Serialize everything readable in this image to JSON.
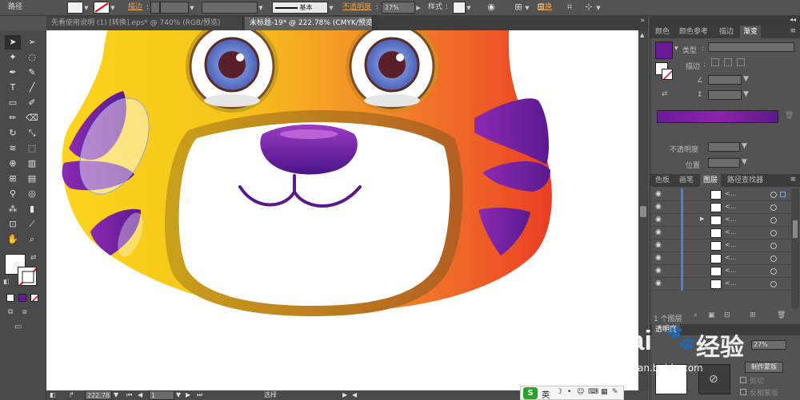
{
  "control_bar": {
    "object_type": "路径",
    "stroke_label": "描边",
    "stroke_style_label": "基本",
    "opacity_label": "不透明度",
    "opacity_value": "27%",
    "style_label": "样式",
    "transform_label": "变换"
  },
  "document_tabs": [
    {
      "label": "先看使用说明 (1) [转换].eps* @ 740% (RGB/预览)",
      "active": false
    },
    {
      "label": "未标题-19* @ 222.78% (CMYK/预览)",
      "active": true
    }
  ],
  "tools": [
    {
      "icon": "selection-arrow-icon",
      "glyph": "➤"
    },
    {
      "icon": "direct-selection-icon",
      "glyph": "➢"
    },
    {
      "icon": "magic-wand-icon",
      "glyph": "✦"
    },
    {
      "icon": "lasso-icon",
      "glyph": "◌"
    },
    {
      "icon": "pen-icon",
      "glyph": "✒"
    },
    {
      "icon": "curvature-icon",
      "glyph": "✎"
    },
    {
      "icon": "type-icon",
      "glyph": "T"
    },
    {
      "icon": "line-icon",
      "glyph": "╱"
    },
    {
      "icon": "rectangle-icon",
      "glyph": "▭"
    },
    {
      "icon": "paintbrush-icon",
      "glyph": "✐"
    },
    {
      "icon": "pencil-icon",
      "glyph": "✏"
    },
    {
      "icon": "eraser-icon",
      "glyph": "⌫"
    },
    {
      "icon": "rotate-icon",
      "glyph": "↻"
    },
    {
      "icon": "scale-icon",
      "glyph": "⤡"
    },
    {
      "icon": "warp-icon",
      "glyph": "≋"
    },
    {
      "icon": "free-transform-icon",
      "glyph": "⬚"
    },
    {
      "icon": "shape-builder-icon",
      "glyph": "⊕"
    },
    {
      "icon": "graph-icon",
      "glyph": "▥"
    },
    {
      "icon": "mesh-icon",
      "glyph": "⊞"
    },
    {
      "icon": "gradient-icon",
      "glyph": "▤"
    },
    {
      "icon": "eyedropper-icon",
      "glyph": "⚲"
    },
    {
      "icon": "blend-icon",
      "glyph": "◎"
    },
    {
      "icon": "symbol-sprayer-icon",
      "glyph": "⁂"
    },
    {
      "icon": "column-graph-icon",
      "glyph": "▮"
    },
    {
      "icon": "artboard-icon",
      "glyph": "⊡"
    },
    {
      "icon": "slice-icon",
      "glyph": "⟋"
    },
    {
      "icon": "hand-icon",
      "glyph": "✋"
    },
    {
      "icon": "zoom-icon",
      "glyph": "⌕"
    }
  ],
  "status_bar": {
    "zoom": "222.78",
    "artboard": "1",
    "mode": "选择"
  },
  "panels": {
    "top_tabs": [
      "颜色",
      "颜色参考",
      "描边",
      "渐变"
    ],
    "gradient": {
      "type_label": "类型",
      "stroke_label": "描边",
      "opacity_label": "不透明度",
      "location_label": "位置",
      "gradient_colors": [
        "#6a1b9a",
        "#8e24aa",
        "#5a1a8e"
      ]
    },
    "mid_tabs": [
      "色板",
      "画笔",
      "图层",
      "路径查找器"
    ],
    "layers": [
      "<...",
      "<...",
      "<...",
      "<...",
      "<...",
      "<...",
      "<...",
      "<..."
    ],
    "layer_count": "1 个图层",
    "bottom": {
      "transparency_label": "透明度",
      "opacity_value": "27%",
      "make_mask": "制作蒙版",
      "clip": "剪切",
      "invert_mask": "反相蒙版"
    }
  },
  "ime": {
    "logo": "S",
    "lang": "英"
  },
  "watermark": {
    "brand": "Bai",
    "brand2": "经验",
    "url": "jingyan.baidu.com"
  },
  "artwork": {
    "colors": {
      "face_left": "#fcd41d",
      "face_right": "#ea3e25",
      "stripe": "#6b1f9c",
      "nose": "#6a1b9a",
      "eye_iris": "#5e7fd2"
    }
  }
}
